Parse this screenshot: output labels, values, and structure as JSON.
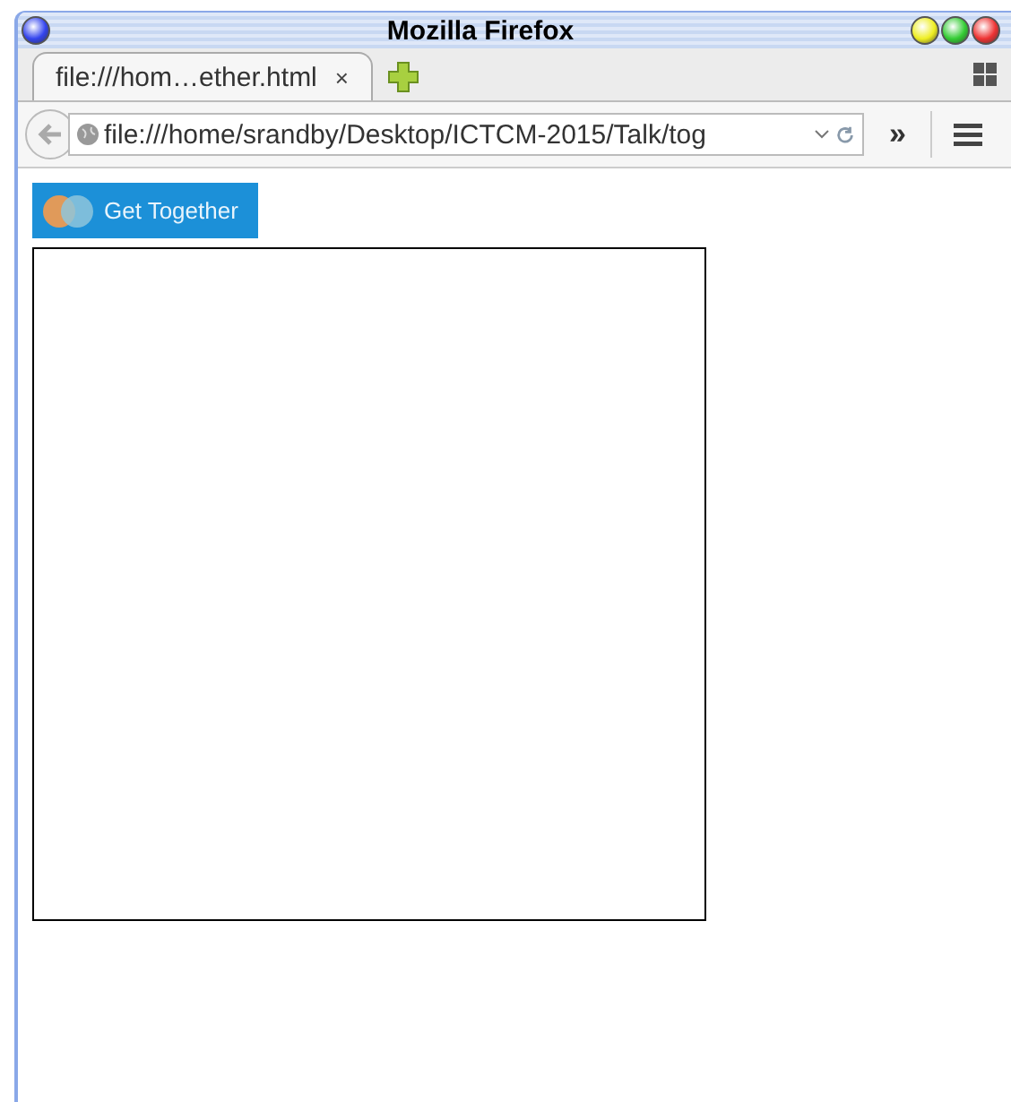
{
  "window": {
    "title": "Mozilla Firefox"
  },
  "tabs": [
    {
      "label": "file:///hom…ether.html",
      "close": "×",
      "selected": true
    }
  ],
  "url": "file:///home/srandby/Desktop/ICTCM-2015/Talk/tog",
  "overflow": "»",
  "page": {
    "button": "Get Together"
  }
}
